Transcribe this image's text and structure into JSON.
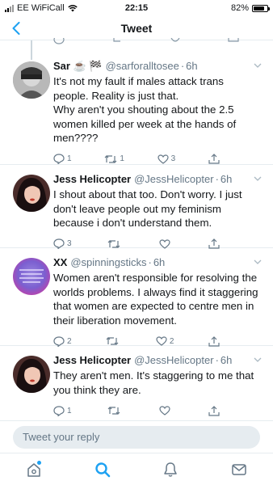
{
  "status_bar": {
    "carrier": "EE WiFiCall",
    "time": "22:15",
    "battery": "82%",
    "battery_level": 0.82
  },
  "header": {
    "title": "Tweet",
    "back_icon": "chevron-left-icon"
  },
  "tweets": [
    {
      "name": "Sar ☕ 🏁",
      "handle": "@sarforalltosee",
      "time": "6h",
      "text": "It's not my fault if males attack trans people. Reality is just that.\nWhy aren't you shouting about the 2.5 women killed per week at the hands of men????",
      "replies": "1",
      "retweets": "1",
      "likes": "3"
    },
    {
      "name": "Jess Helicopter",
      "handle": "@JessHelicopter",
      "time": "6h",
      "text": "I shout about that too. Don't worry. I just don't leave people out my feminism because i don't understand them.",
      "replies": "3",
      "retweets": "",
      "likes": ""
    },
    {
      "name": "XX",
      "handle": "@spinningsticks",
      "time": "6h",
      "text": "Women aren't responsible for resolving the worlds problems. I always find it staggering that women are expected to centre men in their liberation movement.",
      "replies": "2",
      "retweets": "",
      "likes": "2"
    },
    {
      "name": "Jess Helicopter",
      "handle": "@JessHelicopter",
      "time": "6h",
      "text": "They aren't men. It's staggering to me that you think they are.",
      "replies": "1",
      "retweets": "",
      "likes": ""
    }
  ],
  "reply": {
    "placeholder": "Tweet your reply"
  },
  "tab_bar": {
    "items": [
      "home-icon",
      "search-icon",
      "notifications-icon",
      "messages-icon"
    ],
    "active": "search-icon"
  },
  "colors": {
    "accent": "#1da1f2",
    "muted": "#657786",
    "divider": "#e6ecf0"
  }
}
